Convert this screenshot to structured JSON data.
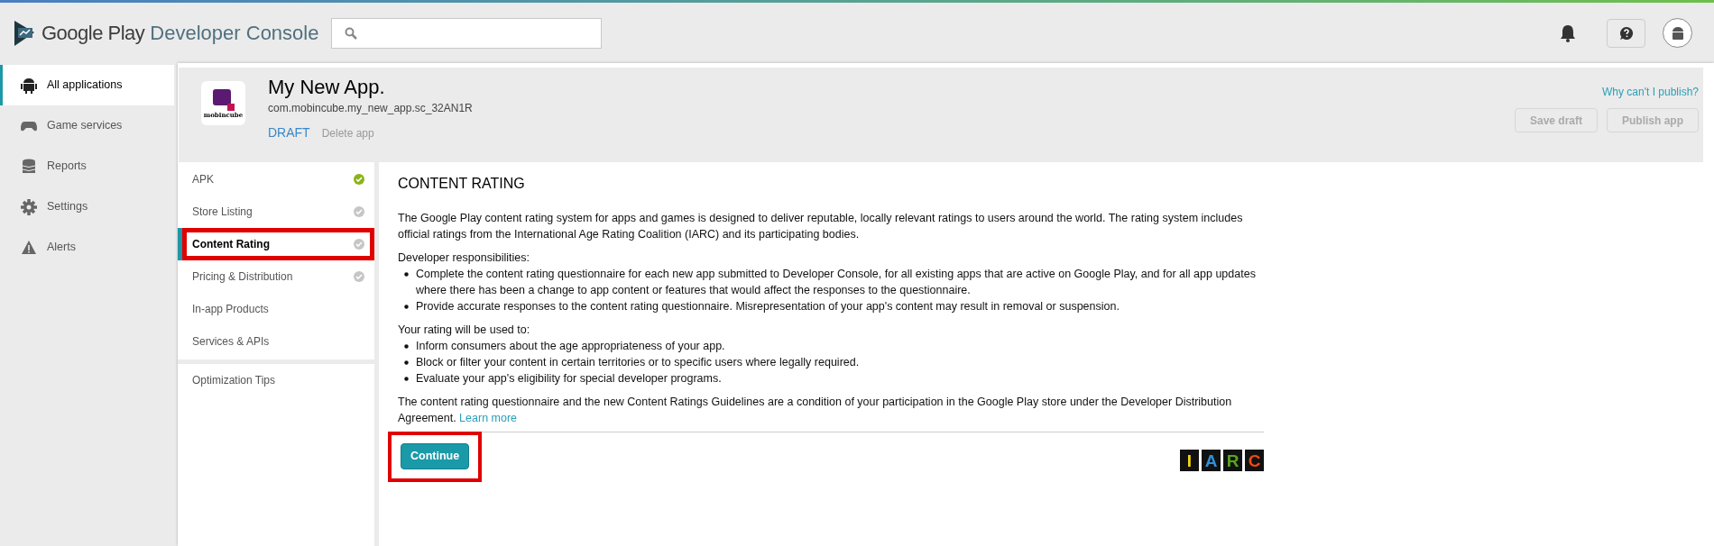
{
  "header": {
    "brand": "Google Play",
    "product": "Developer Console"
  },
  "nav": [
    {
      "label": "All applications",
      "selected": true
    },
    {
      "label": "Game services",
      "selected": false
    },
    {
      "label": "Reports",
      "selected": false
    },
    {
      "label": "Settings",
      "selected": false
    },
    {
      "label": "Alerts",
      "selected": false
    }
  ],
  "app": {
    "name": "My New App.",
    "icon_label": "mobincube",
    "package": "com.mobincube.my_new_app.sc_32AN1R",
    "state": "DRAFT",
    "delete": "Delete app",
    "help_link": "Why can't I publish?",
    "buttons": [
      {
        "label": "Save draft",
        "disabled": true
      },
      {
        "label": "Publish app",
        "disabled": true
      }
    ]
  },
  "subnav": [
    {
      "label": "APK",
      "kind": "done",
      "selected": false,
      "highlighted": false
    },
    {
      "label": "Store Listing",
      "kind": "pending",
      "selected": false,
      "highlighted": false
    },
    {
      "label": "Content Rating",
      "kind": "pending",
      "selected": true,
      "highlighted": true
    },
    {
      "label": "Pricing & Distribution",
      "kind": "pending",
      "selected": false,
      "highlighted": false
    },
    {
      "label": "In-app Products",
      "kind": "plain",
      "selected": false,
      "highlighted": false
    },
    {
      "label": "Services & APIs",
      "kind": "plain",
      "selected": false,
      "highlighted": false
    }
  ],
  "subnav_extra": [
    {
      "label": "Optimization Tips",
      "selected": false
    }
  ],
  "content": {
    "title": "CONTENT RATING",
    "intro": "The Google Play content rating system for apps and games is designed to deliver reputable, locally relevant ratings to users around the world. The rating system includes official ratings from the International Age Rating Coalition (IARC) and its participating bodies.",
    "sections": [
      {
        "heading": "Developer responsibilities:",
        "items": [
          "Complete the content rating questionnaire for each new app submitted to Developer Console, for all existing apps that are active on Google Play, and for all app updates where there has been a change to app content or features that would affect the responses to the questionnaire.",
          "Provide accurate responses to the content rating questionnaire. Misrepresentation of your app's content may result in removal or suspension."
        ]
      },
      {
        "heading": "Your rating will be used to:",
        "items": [
          "Inform consumers about the age appropriateness of your app.",
          "Block or filter your content in certain territories or to specific users where legally required.",
          "Evaluate your app's eligibility for special developer programs."
        ]
      }
    ],
    "closing": "The content rating questionnaire and the new Content Ratings Guidelines are a condition of your participation in the Google Play store under the Developer Distribution Agreement.",
    "link": "Learn more",
    "continue": {
      "label": "Continue",
      "highlighted": true
    },
    "logo": [
      "I",
      "A",
      "R",
      "C"
    ]
  }
}
